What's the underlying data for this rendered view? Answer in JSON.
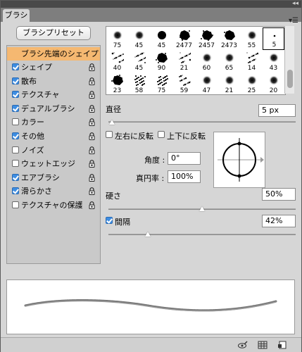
{
  "panel": {
    "tab_label": "ブラシ",
    "preset_button": "ブラシプリセット",
    "menu_icon": "panel-menu-icon",
    "collapse_icon": "collapse-icon"
  },
  "options": [
    {
      "label": "ブラシ先端のシェイプ",
      "checkbox": false,
      "checked": false,
      "selected": true,
      "lock": false
    },
    {
      "label": "シェイプ",
      "checkbox": true,
      "checked": true,
      "lock": true
    },
    {
      "label": "散布",
      "checkbox": true,
      "checked": true,
      "lock": true
    },
    {
      "label": "テクスチャ",
      "checkbox": true,
      "checked": true,
      "lock": true
    },
    {
      "label": "デュアルブラシ",
      "checkbox": true,
      "checked": true,
      "lock": true
    },
    {
      "label": "カラー",
      "checkbox": true,
      "checked": false,
      "lock": true
    },
    {
      "label": "その他",
      "checkbox": true,
      "checked": true,
      "lock": true
    },
    {
      "label": "ノイズ",
      "checkbox": true,
      "checked": false,
      "lock": true
    },
    {
      "label": "ウェットエッジ",
      "checkbox": true,
      "checked": false,
      "lock": true
    },
    {
      "label": "エアブラシ",
      "checkbox": true,
      "checked": true,
      "lock": true
    },
    {
      "label": "滑らかさ",
      "checkbox": true,
      "checked": true,
      "lock": true
    },
    {
      "label": "テクスチャの保護",
      "checkbox": true,
      "checked": false,
      "lock": true
    }
  ],
  "brushes": [
    {
      "size": "75",
      "kind": "soft"
    },
    {
      "size": "45",
      "kind": "soft"
    },
    {
      "size": "45",
      "kind": "hard"
    },
    {
      "size": "2477",
      "kind": "splatter"
    },
    {
      "size": "2457",
      "kind": "splatter"
    },
    {
      "size": "2473",
      "kind": "splatter"
    },
    {
      "size": "55",
      "kind": "soft"
    },
    {
      "size": "5",
      "kind": "dot",
      "selected": true
    },
    {
      "size": "40",
      "kind": "speckle"
    },
    {
      "size": "45",
      "kind": "speckle"
    },
    {
      "size": "90",
      "kind": "splatter"
    },
    {
      "size": "21",
      "kind": "speckle"
    },
    {
      "size": "60",
      "kind": "soft"
    },
    {
      "size": "65",
      "kind": "soft"
    },
    {
      "size": "14",
      "kind": "speckle"
    },
    {
      "size": "43",
      "kind": "soft"
    },
    {
      "size": "23",
      "kind": "splatter"
    },
    {
      "size": "58",
      "kind": "texture"
    },
    {
      "size": "75",
      "kind": "texture"
    },
    {
      "size": "59",
      "kind": "speckle"
    },
    {
      "size": "47",
      "kind": "soft"
    },
    {
      "size": "21",
      "kind": "soft"
    },
    {
      "size": "25",
      "kind": "soft"
    },
    {
      "size": "20",
      "kind": "soft"
    }
  ],
  "tip": {
    "diameter_label": "直径",
    "diameter_value": "5 px",
    "diameter_level": 0.02,
    "flip_x_label": "左右に反転",
    "flip_y_label": "上下に反転",
    "flip_x": false,
    "flip_y": false,
    "angle_label": "角度 :",
    "angle_value": "0°",
    "roundness_label": "真円率 :",
    "roundness_value": "100%",
    "hardness_label": "硬さ",
    "hardness_value": "50%",
    "hardness_level": 0.5,
    "spacing_label": "間隔",
    "spacing_value": "42%",
    "spacing_checked": true,
    "spacing_level": 0.21
  },
  "footer_icons": [
    "eye-brush-icon",
    "grid-icon",
    "new-preset-icon"
  ]
}
